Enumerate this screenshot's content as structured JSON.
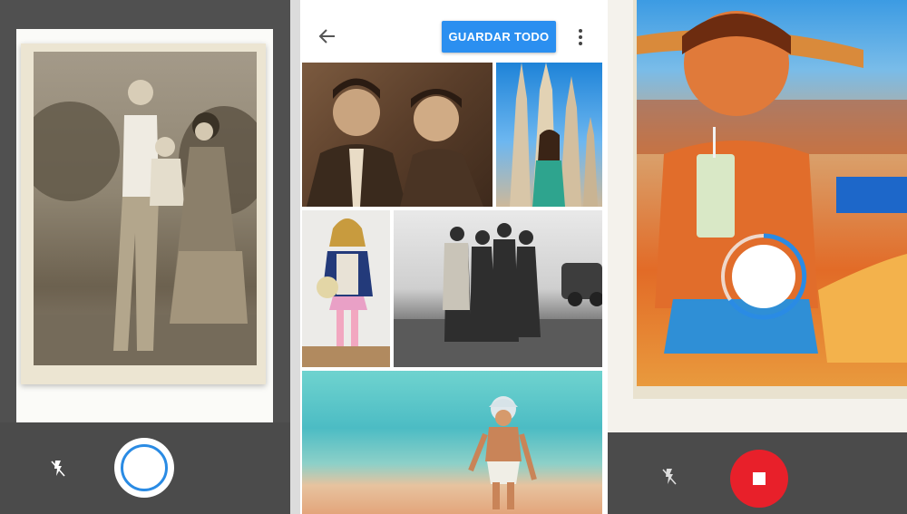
{
  "screens": {
    "scanner": {
      "flash_icon": "flash-off-icon",
      "shutter_icon": "shutter-ring-icon"
    },
    "results": {
      "back_icon": "arrow-back-icon",
      "save_all_label": "GUARDAR TODO",
      "more_icon": "more-vert-icon",
      "photos": [
        {
          "subject": "couple-portrait"
        },
        {
          "subject": "girl-at-sagrada-familia"
        },
        {
          "subject": "girl-with-teddy-bear"
        },
        {
          "subject": "group-outdoors"
        },
        {
          "subject": "child-on-beach"
        }
      ]
    },
    "capturing": {
      "flash_icon": "flash-off-icon",
      "stop_icon": "stop-icon",
      "scan_target_icon": "scan-target-circle-icon"
    }
  },
  "colors": {
    "accent_blue": "#2b8ff0",
    "record_red": "#e8202a",
    "bar_gray": "#4b4b4b"
  }
}
